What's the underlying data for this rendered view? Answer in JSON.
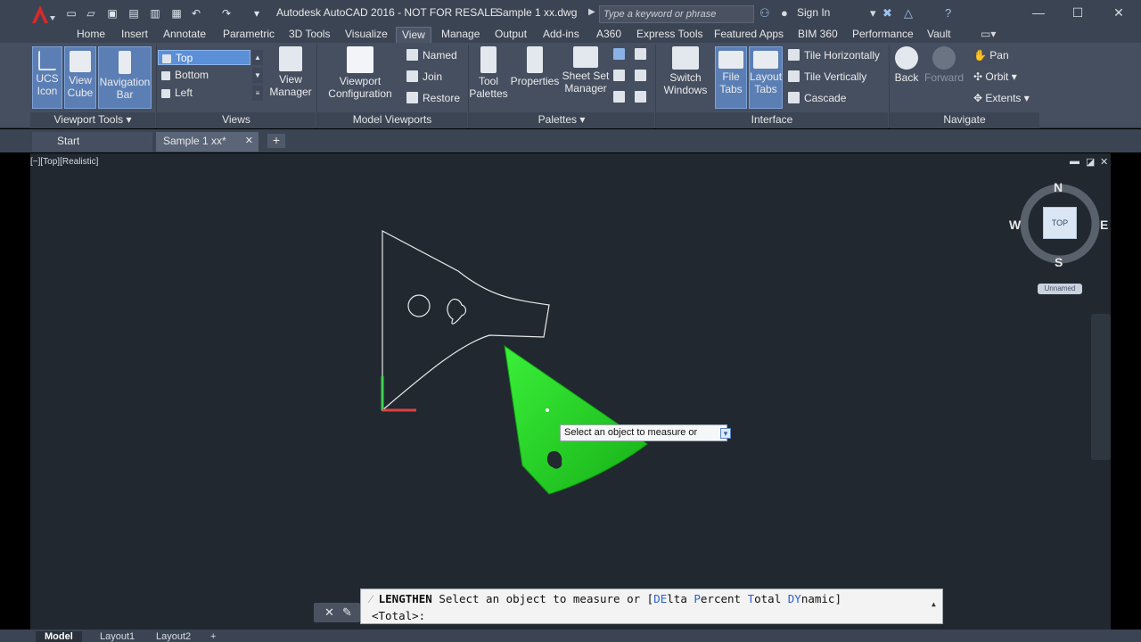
{
  "titlebar": {
    "app_title": "Autodesk AutoCAD 2016 - NOT FOR RESALE",
    "file_title": "Sample 1 xx.dwg",
    "search_placeholder": "Type a keyword or phrase",
    "sign_in": "Sign In"
  },
  "ribbon_tabs": [
    "Home",
    "Insert",
    "Annotate",
    "Parametric",
    "3D Tools",
    "Visualize",
    "View",
    "Manage",
    "Output",
    "Add-ins",
    "A360",
    "Express Tools",
    "Featured Apps",
    "BIM 360",
    "Performance",
    "Vault"
  ],
  "active_ribbon_tab": "View",
  "panels": {
    "viewport_tools": {
      "title": "Viewport Tools",
      "ucs_icon_l1": "UCS",
      "ucs_icon_l2": "Icon",
      "view_cube_l1": "View",
      "view_cube_l2": "Cube",
      "nav_bar_l1": "Navigation",
      "nav_bar_l2": "Bar"
    },
    "views": {
      "title": "Views",
      "items": [
        "Top",
        "Bottom",
        "Left"
      ],
      "manager_l1": "View",
      "manager_l2": "Manager"
    },
    "model_viewports": {
      "title": "Model Viewports",
      "config_l1": "Viewport",
      "config_l2": "Configuration",
      "named": "Named",
      "join": "Join",
      "restore": "Restore"
    },
    "palettes": {
      "title": "Palettes",
      "tool_l1": "Tool",
      "tool_l2": "Palettes",
      "properties": "Properties",
      "sheetset_l1": "Sheet Set",
      "sheetset_l2": "Manager"
    },
    "interface": {
      "title": "Interface",
      "switch_l1": "Switch",
      "switch_l2": "Windows",
      "file_tabs_l1": "File",
      "file_tabs_l2": "Tabs",
      "layout_tabs_l1": "Layout",
      "layout_tabs_l2": "Tabs",
      "tile_h": "Tile Horizontally",
      "tile_v": "Tile Vertically",
      "cascade": "Cascade"
    },
    "navigate": {
      "title": "Navigate",
      "back": "Back",
      "forward": "Forward",
      "pan": "Pan",
      "orbit": "Orbit",
      "extents": "Extents"
    }
  },
  "file_tabs": {
    "start": "Start",
    "active": "Sample 1 xx*"
  },
  "viewport": {
    "label": "[−][Top][Realistic]",
    "viewcube": {
      "n": "N",
      "s": "S",
      "e": "E",
      "w": "W",
      "face": "TOP",
      "wcs": "Unnamed"
    }
  },
  "tooltip": {
    "text": "Select an object to measure or"
  },
  "command_line": {
    "command": "LENGTHEN",
    "prompt": "Select an object to measure or [",
    "opt1_key": "DE",
    "opt1_rest": "lta",
    "opt2_key": "P",
    "opt2_rest": "ercent",
    "opt3_key": "T",
    "opt3_rest": "otal",
    "opt4_key": "DY",
    "opt4_rest": "namic",
    "close": "]",
    "line2": "<Total>:"
  },
  "statusbar": {
    "tabs": [
      "Model",
      "Layout1",
      "Layout2"
    ]
  },
  "colors": {
    "title_bg": "#3b4453",
    "ribbon_bg": "#454f60",
    "viewport_bg": "#212830",
    "selected_shape": "#2ee62e",
    "accent": "#5b8fd7"
  }
}
